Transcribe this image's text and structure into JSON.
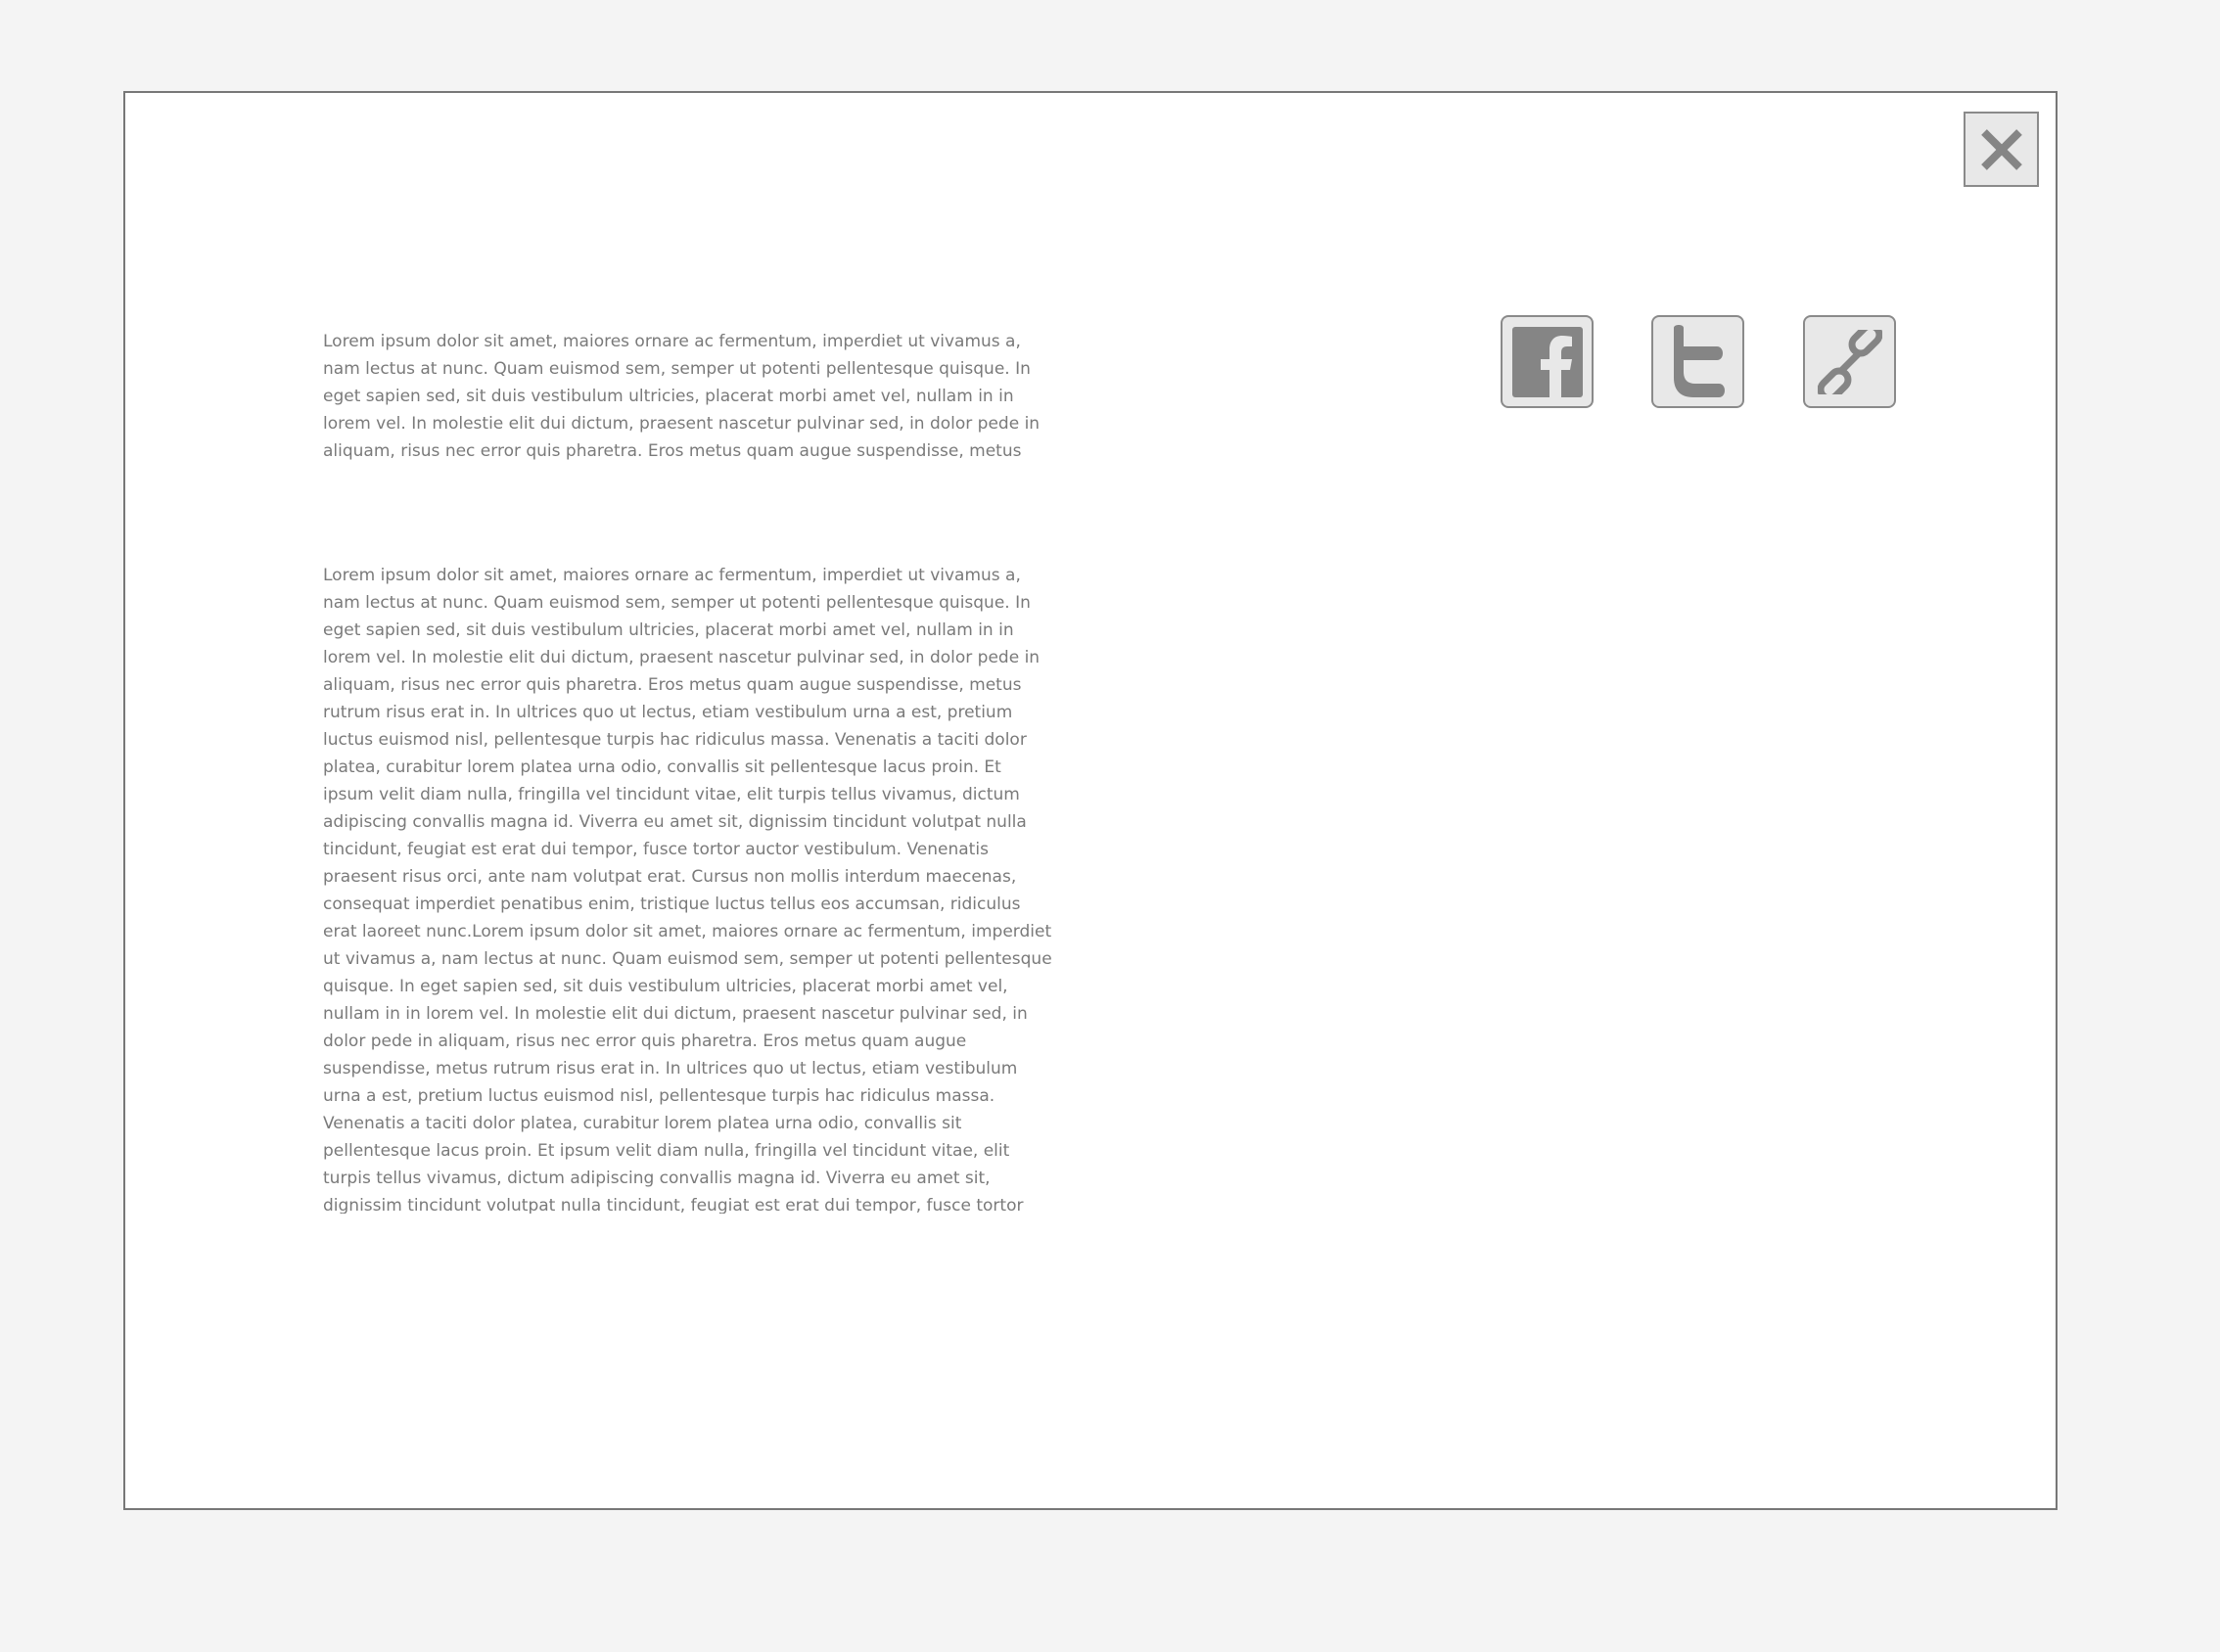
{
  "dialog": {
    "close_icon": "close-icon",
    "paragraphs": [
      "Lorem ipsum dolor sit amet, maiores ornare ac fermentum, imperdiet ut vivamus a, nam lectus at nunc. Quam euismod sem, semper ut potenti pellentesque quisque. In eget sapien sed, sit duis vestibulum ultricies, placerat morbi amet vel, nullam in in lorem vel. In molestie elit dui dictum, praesent nascetur pulvinar sed, in dolor pede in aliquam, risus nec error quis pharetra. Eros metus quam augue suspendisse, metus rutrum risus erat in.  In",
      "Lorem ipsum dolor sit amet, maiores ornare ac fermentum, imperdiet ut vivamus a, nam lectus at nunc. Quam euismod sem, semper ut potenti pellentesque quisque. In eget sapien sed, sit duis vestibulum ultricies, placerat morbi amet vel, nullam in in lorem vel. In molestie elit dui dictum, praesent nascetur pulvinar sed, in dolor pede in aliquam, risus nec error quis pharetra. Eros metus quam augue suspendisse, metus rutrum risus erat in.  In ultrices quo ut lectus, etiam vestibulum urna a est, pretium luctus euismod nisl, pellentesque turpis hac ridiculus massa. Venenatis a taciti dolor platea, curabitur lorem platea urna odio, convallis sit pellentesque lacus proin. Et ipsum velit diam nulla, fringilla vel tincidunt vitae, elit turpis tellus vivamus, dictum adipiscing convallis magna id. Viverra eu amet sit, dignissim tincidunt volutpat nulla tincidunt, feugiat est erat dui tempor, fusce tortor auctor vestibulum. Venenatis praesent risus orci, ante nam volutpat erat. Cursus non mollis interdum maecenas, consequat imperdiet penatibus enim, tristique luctus tellus eos accumsan, ridiculus erat laoreet nunc.Lorem ipsum dolor sit amet, maiores ornare ac fermentum, imperdiet ut vivamus a, nam lectus at nunc. Quam euismod sem, semper ut potenti pellentesque quisque. In eget sapien sed, sit duis vestibulum ultricies, placerat morbi amet vel, nullam in in lorem vel. In molestie elit dui dictum, praesent nascetur pulvinar sed, in dolor pede in aliquam, risus nec error quis pharetra. Eros metus quam augue suspendisse, metus rutrum risus erat in.  In ultrices quo ut lectus, etiam vestibulum urna a est, pretium luctus euismod nisl, pellentesque turpis hac ridiculus massa. Venenatis a taciti dolor platea, curabitur lorem platea urna odio, convallis sit pellentesque lacus proin. Et ipsum velit diam nulla, fringilla vel tincidunt vitae, elit turpis tellus vivamus, dictum adipiscing convallis magna id. Viverra eu amet sit, dignissim tincidunt volutpat nulla tincidunt, feugiat est erat dui tempor, fusce tortor auctor vestibulum. Venenatis praesent risus orci, ante nam volutpat erat. Cursus non mollis interdum maecenas."
    ]
  },
  "share": {
    "buttons": [
      {
        "icon": "facebook-icon"
      },
      {
        "icon": "twitter-icon"
      },
      {
        "icon": "link-icon"
      }
    ]
  },
  "colors": {
    "page_background": "#f4f4f4",
    "dialog_background": "#ffffff",
    "border": "#777777",
    "icon": "#858585",
    "button_fill": "#e8e8e8",
    "text": "#7a7a7a"
  }
}
